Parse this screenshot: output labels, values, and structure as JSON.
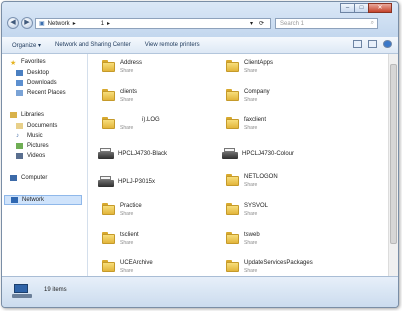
{
  "address": {
    "segments": [
      "Network",
      "▸",
      "1",
      "▸"
    ]
  },
  "search": {
    "placeholder": "Search 1"
  },
  "window_controls": {
    "minimize": "–",
    "maximize": "□",
    "close": "✕"
  },
  "toolbar": {
    "organize": "Organize ▾",
    "network_sharing": "Network and Sharing Center",
    "remote_printers": "View remote printers"
  },
  "sidebar": {
    "favorites": "Favorites",
    "favorites_items": [
      "Desktop",
      "Downloads",
      "Recent Places"
    ],
    "libraries": "Libraries",
    "libraries_items": [
      "Documents",
      "Music",
      "Pictures",
      "Videos"
    ],
    "computer": "Computer",
    "network": "Network"
  },
  "items": [
    {
      "name": "Address",
      "sub": "Share",
      "icon": "folder-icon"
    },
    {
      "name": "ClientApps",
      "sub": "Share",
      "icon": "folder-icon"
    },
    {
      "name": "clients",
      "sub": "Share",
      "icon": "folder-icon"
    },
    {
      "name": "Company",
      "sub": "Share",
      "icon": "folder-icon"
    },
    {
      "name": "i).LOG",
      "sub": "Share",
      "icon": "folder-icon"
    },
    {
      "name": "faxclient",
      "sub": "Share",
      "icon": "folder-icon"
    },
    {
      "name": "HPCLJ4730-Black",
      "sub": "",
      "icon": "printer-icon"
    },
    {
      "name": "HPCLJ4730-Colour",
      "sub": "",
      "icon": "printer-icon"
    },
    {
      "name": "HPLJ-P3015x",
      "sub": "",
      "icon": "printer-icon"
    },
    {
      "name": "NETLOGON",
      "sub": "Share",
      "icon": "folder-icon"
    },
    {
      "name": "Practice",
      "sub": "Share",
      "icon": "folder-icon"
    },
    {
      "name": "SYSVOL",
      "sub": "Share",
      "icon": "folder-icon"
    },
    {
      "name": "tsclient",
      "sub": "Share",
      "icon": "folder-icon"
    },
    {
      "name": "tsweb",
      "sub": "Share",
      "icon": "folder-icon"
    },
    {
      "name": "UCEArchive",
      "sub": "Share",
      "icon": "folder-icon"
    },
    {
      "name": "UpdateServicesPackages",
      "sub": "Share",
      "icon": "folder-icon"
    }
  ],
  "status": {
    "count": "19 items"
  }
}
